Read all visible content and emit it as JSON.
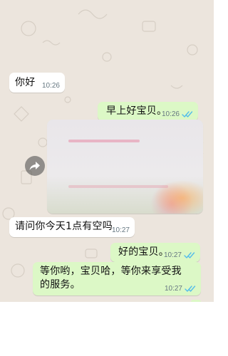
{
  "messages": [
    {
      "id": "m1",
      "direction": "incoming",
      "text": "你好",
      "time": "10:26"
    },
    {
      "id": "m2",
      "direction": "outgoing",
      "text": "早上好宝贝。",
      "time": "10:26",
      "status": "read"
    },
    {
      "id": "m3",
      "direction": "incoming",
      "type": "image"
    },
    {
      "id": "m4",
      "direction": "incoming",
      "text": "请问你今天1点有空吗",
      "time": "10:27"
    },
    {
      "id": "m5",
      "direction": "outgoing",
      "text": "好的宝贝。",
      "time": "10:27",
      "status": "read"
    },
    {
      "id": "m6",
      "direction": "outgoing",
      "text": "等你哟，宝贝哈，等你来享受我的服务。",
      "time": "10:27",
      "status": "read"
    }
  ],
  "colors": {
    "chat_background": "#ece5dd",
    "incoming_bubble": "#ffffff",
    "outgoing_bubble": "#dcf8c6",
    "read_ticks": "#53bdeb",
    "timestamp": "#667781"
  },
  "icons": {
    "forward": "forward-arrow-icon",
    "read_receipt": "double-check-icon"
  }
}
